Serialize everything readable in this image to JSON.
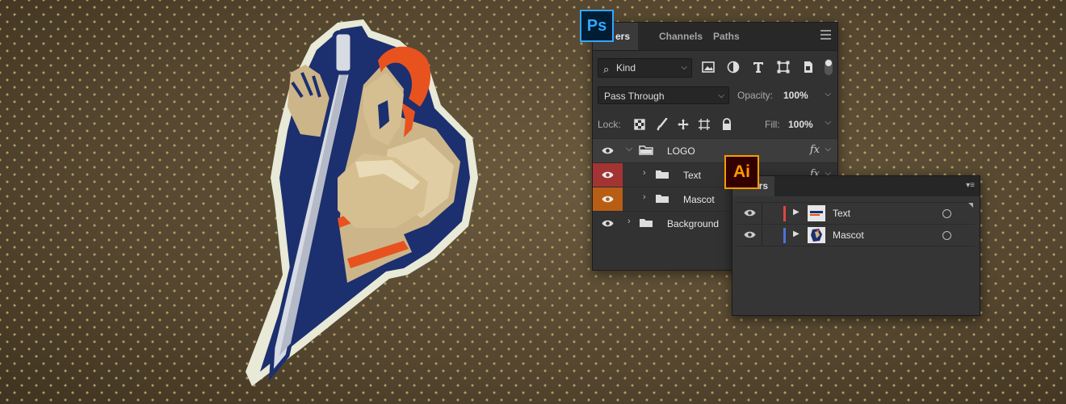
{
  "photoshop": {
    "badge": "Ps",
    "tabs": [
      {
        "label": "ers",
        "active": true
      },
      {
        "label": "Channels",
        "active": false
      },
      {
        "label": "Paths",
        "active": false
      }
    ],
    "filter": {
      "kind_label": "Kind",
      "icons": [
        "image-filter-icon",
        "adjustment-filter-icon",
        "type-filter-icon",
        "shape-filter-icon",
        "smart-object-filter-icon"
      ]
    },
    "blend_mode": "Pass Through",
    "opacity_label": "Opacity:",
    "opacity_value": "100%",
    "lock_label": "Lock:",
    "fill_label": "Fill:",
    "fill_value": "100%",
    "layers": [
      {
        "name": "LOGO",
        "expanded": true,
        "fx": "fx",
        "eye_color": "none"
      },
      {
        "name": "Text",
        "expanded": false,
        "fx": "fx",
        "eye_color": "#a33434"
      },
      {
        "name": "Mascot",
        "expanded": false,
        "fx": "",
        "eye_color": "#b85d14"
      },
      {
        "name": "Background",
        "expanded": false,
        "fx": "",
        "eye_color": "none"
      }
    ]
  },
  "illustrator": {
    "badge": "Ai",
    "tab_label": "ers",
    "layers": [
      {
        "name": "Text",
        "color": "#e04545"
      },
      {
        "name": "Mascot",
        "color": "#4a73d9"
      }
    ]
  },
  "colors": {
    "mascot_navy": "#1c2f6e",
    "mascot_orange": "#e8521f",
    "mascot_tan": "#cdb58a",
    "mascot_cream": "#e8e9d6",
    "ps_blue": "#31a8ff",
    "ai_orange": "#ff9a00"
  }
}
